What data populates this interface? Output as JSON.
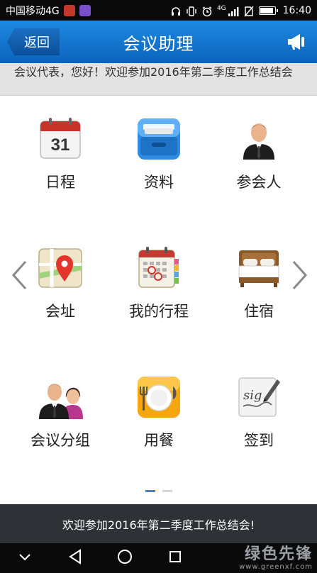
{
  "status_bar": {
    "carrier": "中国移动4G",
    "network": "4G",
    "time": "16:40",
    "icons": [
      "headphones-icon",
      "vibrate-icon",
      "alarm-icon",
      "signal-icon",
      "no-sim-icon",
      "battery-icon"
    ]
  },
  "header": {
    "back_label": "返回",
    "title": "会议助理",
    "speaker_icon": "megaphone-icon",
    "color": "#1273cf"
  },
  "notice": {
    "text": "会议代表，您好！欢迎参加2016年第二季度工作总结会"
  },
  "tiles": [
    {
      "label": "日程",
      "icon": "calendar-icon",
      "calendar_day": "31"
    },
    {
      "label": "资料",
      "icon": "file-drawer-icon"
    },
    {
      "label": "参会人",
      "icon": "person-icon"
    },
    {
      "label": "会址",
      "icon": "map-pin-icon"
    },
    {
      "label": "我的行程",
      "icon": "itinerary-calendar-icon"
    },
    {
      "label": "住宿",
      "icon": "bed-icon"
    },
    {
      "label": "会议分组",
      "icon": "group-icon"
    },
    {
      "label": "用餐",
      "icon": "dining-icon"
    },
    {
      "label": "签到",
      "icon": "signature-icon",
      "sig_text": "sig"
    }
  ],
  "pager": {
    "pages": 2,
    "active": 0
  },
  "footer": {
    "text": "欢迎参加2016年第二季度工作总结会!"
  },
  "watermark": {
    "brand": "绿色先锋",
    "url": "www.greenxf.com"
  }
}
